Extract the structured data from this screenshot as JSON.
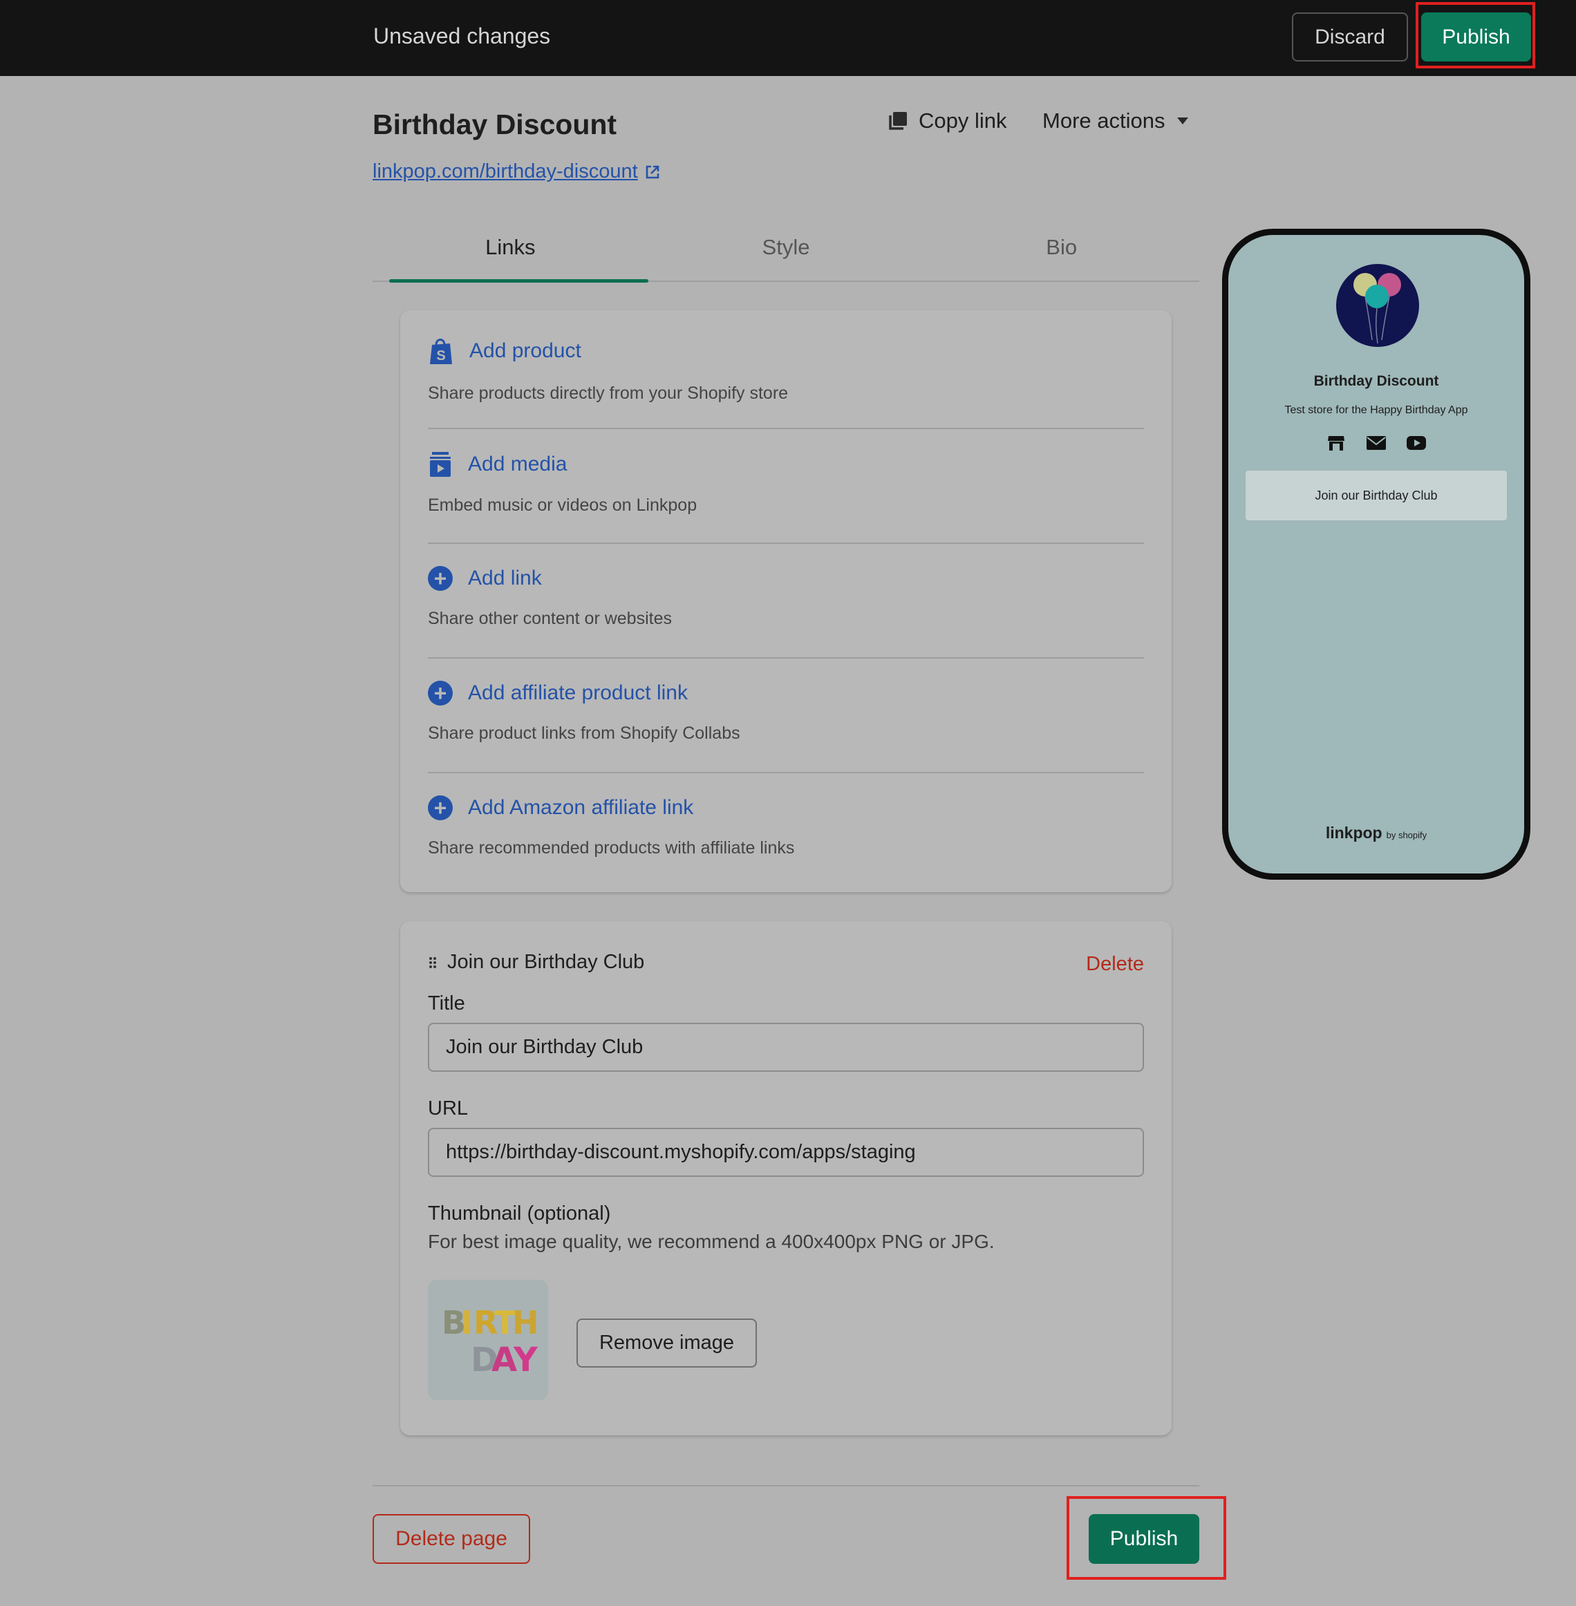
{
  "topbar": {
    "title": "Unsaved changes",
    "discard_label": "Discard",
    "publish_label": "Publish"
  },
  "header": {
    "title": "Birthday Discount",
    "copy_link_label": "Copy link",
    "more_actions_label": "More actions",
    "url": "linkpop.com/birthday-discount"
  },
  "tabs": [
    {
      "label": "Links",
      "active": true
    },
    {
      "label": "Style",
      "active": false
    },
    {
      "label": "Bio",
      "active": false
    }
  ],
  "add_items": [
    {
      "title": "Add product",
      "desc": "Share products directly from your Shopify store",
      "icon": "shopify-bag-icon"
    },
    {
      "title": "Add media",
      "desc": "Embed music or videos on Linkpop",
      "icon": "media-icon"
    },
    {
      "title": "Add link",
      "desc": "Share other content or websites",
      "icon": "plus-circle-icon"
    },
    {
      "title": "Add affiliate product link",
      "desc": "Share product links from Shopify Collabs",
      "icon": "plus-circle-icon"
    },
    {
      "title": "Add Amazon affiliate link",
      "desc": "Share recommended products with affiliate links",
      "icon": "plus-circle-icon"
    }
  ],
  "link_card": {
    "heading": "Join our Birthday Club",
    "delete_label": "Delete",
    "title_label": "Title",
    "title_value": "Join our Birthday Club",
    "url_label": "URL",
    "url_value": "https://birthday-discount.myshopify.com/apps/staging",
    "thumbnail_label": "Thumbnail (optional)",
    "thumbnail_hint": "For best image quality, we recommend a 400x400px PNG or JPG.",
    "remove_image_label": "Remove image"
  },
  "footer": {
    "delete_page_label": "Delete page",
    "publish_label": "Publish"
  },
  "preview": {
    "name": "Birthday Discount",
    "bio": "Test store for the Happy Birthday App",
    "link_label": "Join our Birthday Club",
    "brand": "linkpop",
    "brand_suffix": "by shopify",
    "socials": [
      "store-icon",
      "mail-icon",
      "youtube-icon"
    ],
    "background_color": "#9fb8b9"
  },
  "colors": {
    "accent_green": "#0a6f52",
    "link_blue": "#2452a8",
    "danger_red": "#b32a1a",
    "highlight_red": "#e02020"
  }
}
